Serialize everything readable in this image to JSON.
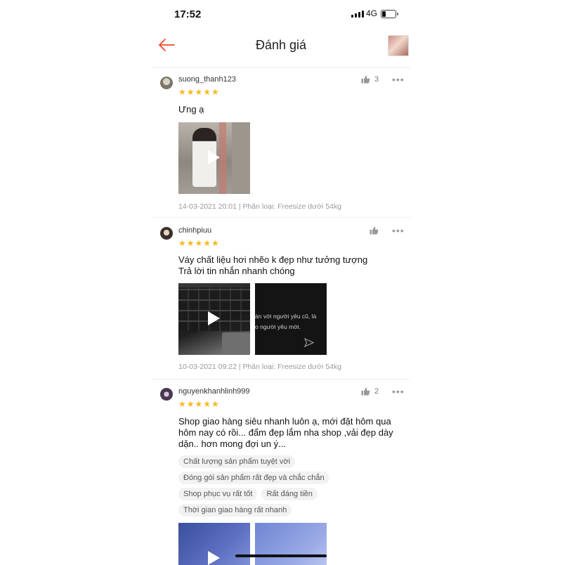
{
  "status_bar": {
    "time": "17:52",
    "network": "4G"
  },
  "header": {
    "title": "Đánh giá"
  },
  "reviews": [
    {
      "username": "suong_thanh123",
      "stars": "★★★★★",
      "likes": "3",
      "text": "Ưng ạ",
      "meta": "14-03-2021 20:01 | Phân loại: Freesize dưới 54kg"
    },
    {
      "username": "chinhpiuu",
      "stars": "★★★★★",
      "likes": "",
      "text_lines": [
        "Váy chất liệu hơi nhẽo k đẹp như tưởng tượng",
        "Trả lời tin nhắn nhanh chóng"
      ],
      "media_caption": "àn với người yêu cũ, là\no người yêu mới.",
      "meta": "10-03-2021 09:22 | Phân loại: Freesize dưới 54kg"
    },
    {
      "username": "nguyenkhanhlinh999",
      "stars": "★★★★★",
      "likes": "2",
      "text_lines": [
        "Shop giao hàng siêu nhanh luôn ạ, mới đặt hôm qua",
        "hôm nay có rồi... đẩm đẹp lắm nha shop ,vải đẹp dày",
        "dặn.. hơn mong đợi un ý..."
      ],
      "tags": [
        "Chất lượng sản phẩm tuyệt vời",
        "Đóng gói sản phẩm rất đẹp và chắc chắn",
        "Shop phục vụ rất tốt",
        "Rất đáng tiền",
        "Thời gian giao hàng rất nhanh"
      ]
    }
  ],
  "colors": {
    "accent": "#ee4d2d",
    "star": "#f6b820"
  }
}
